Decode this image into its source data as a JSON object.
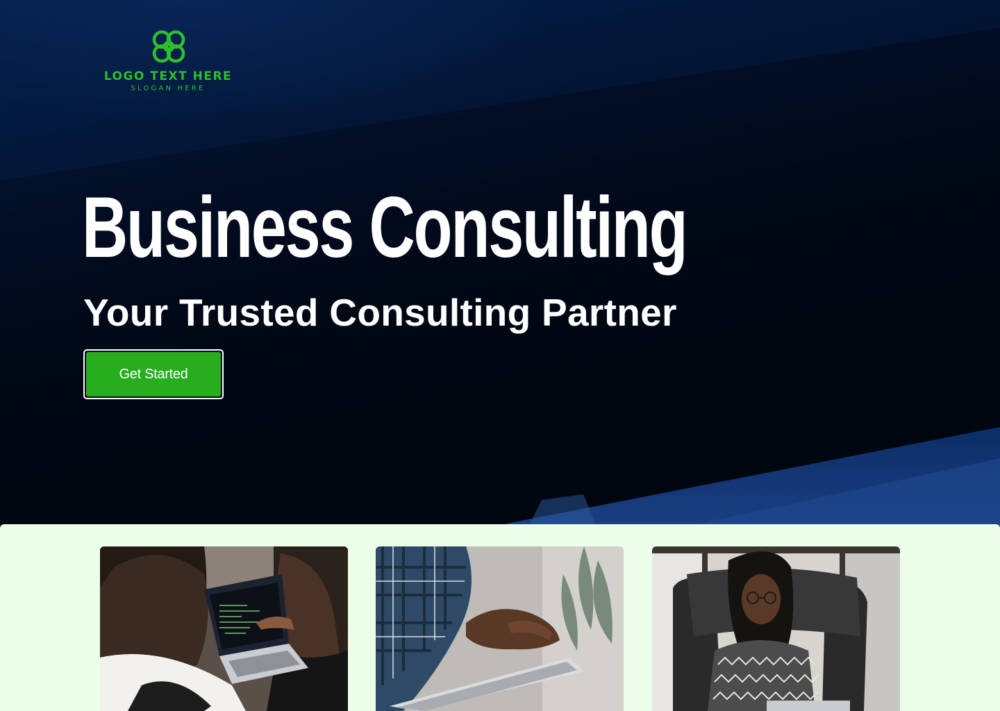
{
  "logo": {
    "name": "LOGO TEXT HERE",
    "slogan": "SLOGAN HERE",
    "icon": "interlocking-knot-icon",
    "color": "#2fbf2a"
  },
  "hero": {
    "title": "Business Consulting",
    "subtitle": "Your Trusted Consulting Partner",
    "cta_label": "Get Started"
  },
  "colors": {
    "hero_background": "#000714",
    "accent_green": "#27ad1e",
    "lower_section_background": "#ecffe9"
  },
  "gallery": [
    {
      "subject": "two-women-laptop-photo"
    },
    {
      "subject": "hand-tablet-photo"
    },
    {
      "subject": "woman-laptop-armchair-photo"
    }
  ]
}
